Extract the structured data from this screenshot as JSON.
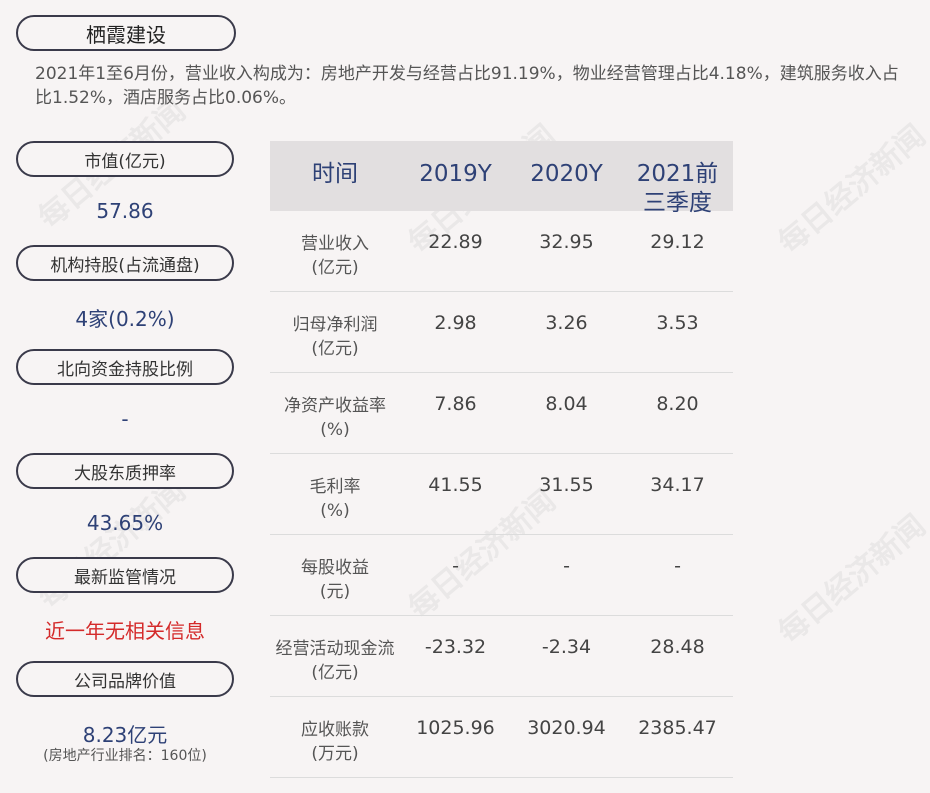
{
  "header": {
    "company": "栖霞建设",
    "description": "2021年1至6月份，营业收入构成为：房地产开发与经营占比91.19%，物业经营管理占比4.18%，建筑服务收入占比1.52%，酒店服务占比0.06%。"
  },
  "metrics": [
    {
      "label": "市值(亿元)",
      "value": "57.86"
    },
    {
      "label": "机构持股(占流通盘)",
      "value": "4家(0.2%)"
    },
    {
      "label": "北向资金持股比例",
      "value": "-"
    },
    {
      "label": "大股东质押率",
      "value": "43.65%"
    },
    {
      "label": "最新监管情况",
      "value": "近一年无相关信息"
    },
    {
      "label": "公司品牌价值",
      "value": "8.23亿元",
      "sub": "(房地产行业排名：160位)"
    }
  ],
  "table": {
    "headers": [
      "时间",
      "2019Y",
      "2020Y",
      "2021前三季度"
    ],
    "rows": [
      {
        "label": "营业收入\n(亿元)",
        "values": [
          "22.89",
          "32.95",
          "29.12"
        ]
      },
      {
        "label": "归母净利润\n(亿元)",
        "values": [
          "2.98",
          "3.26",
          "3.53"
        ]
      },
      {
        "label": "净资产收益率\n(%)",
        "values": [
          "7.86",
          "8.04",
          "8.20"
        ]
      },
      {
        "label": "毛利率\n(%)",
        "values": [
          "41.55",
          "31.55",
          "34.17"
        ]
      },
      {
        "label": "每股收益\n(元)",
        "values": [
          "-",
          "-",
          "-"
        ]
      },
      {
        "label": "经营活动现金流\n(亿元)",
        "values": [
          "-23.32",
          "-2.34",
          "28.48"
        ]
      },
      {
        "label": "应收账款\n(万元)",
        "values": [
          "1025.96",
          "3020.94",
          "2385.47"
        ]
      }
    ]
  },
  "watermark": "每日经济新闻"
}
